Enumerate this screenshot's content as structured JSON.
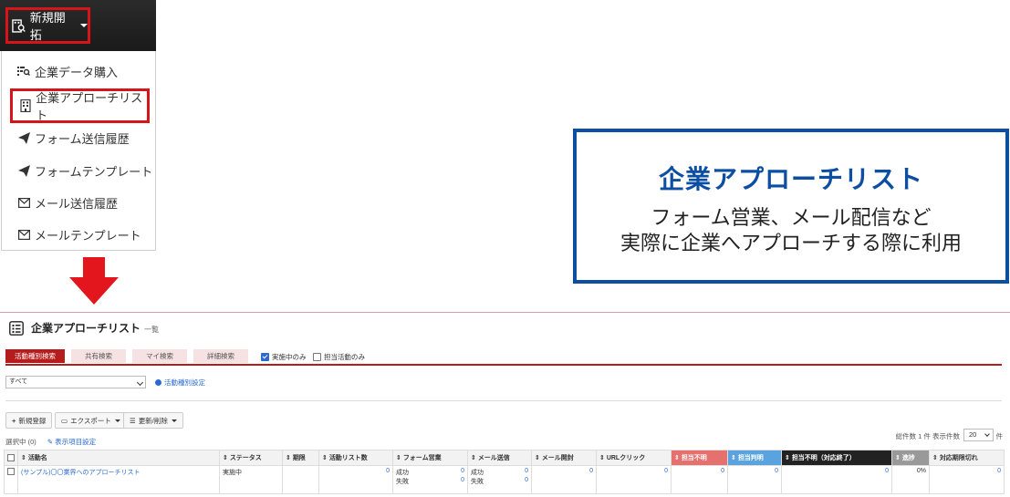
{
  "menu": {
    "button_label": "新規開拓",
    "items": [
      {
        "label": "企業データ購入",
        "icon": "list-search-icon"
      },
      {
        "label": "企業アプローチリスト",
        "icon": "building-icon"
      },
      {
        "label": "フォーム送信履歴",
        "icon": "send-icon"
      },
      {
        "label": "フォームテンプレート",
        "icon": "send-icon"
      },
      {
        "label": "メール送信履歴",
        "icon": "mail-icon"
      },
      {
        "label": "メールテンプレート",
        "icon": "mail-icon"
      }
    ]
  },
  "callout": {
    "title": "企業アプローチリスト",
    "line1": "フォーム営業、メール配信など",
    "line2": "実際に企業へアプローチする際に利用"
  },
  "app": {
    "title": "企業アプローチリスト",
    "subtitle": "一覧",
    "tabs": [
      "活動種別検索",
      "共有検索",
      "マイ検索",
      "詳細検索"
    ],
    "filters": {
      "active_only": "実施中のみ",
      "mine_only": "担当活動のみ"
    },
    "select_value": "すべて",
    "type_settings": "活動種別設定",
    "buttons": {
      "new": "新規登録",
      "export": "エクスポート",
      "update": "更新/削除"
    },
    "count_text": "総件数 1 件 表示件数",
    "page_size": "20",
    "unit": "件",
    "selected_text": "選択中 (0)",
    "display_settings": "表示項目設定",
    "columns": [
      "活動名",
      "ステータス",
      "期限",
      "活動リスト数",
      "フォーム営業",
      "メール送信",
      "メール開封",
      "URLクリック",
      "担当不明",
      "担当判明",
      "担当不明（対応終了）",
      "進捗",
      "対応期限切れ"
    ],
    "row": {
      "name": "(サンプル)〇〇業界へのアプローチリスト",
      "status": "実施中",
      "deadline": "",
      "list_count": "0",
      "form": {
        "success_label": "成功",
        "success": "0",
        "fail_label": "失敗",
        "fail": "0"
      },
      "mail": {
        "success_label": "成功",
        "success": "0",
        "fail_label": "失敗",
        "fail": "0"
      },
      "mail_open": "0",
      "url_click": "0",
      "unknown": "0",
      "known": "0",
      "unknown_closed": "0",
      "progress": "0%",
      "overdue": "0"
    }
  },
  "colors": {
    "accent_red": "#d7141a",
    "callout_blue": "#0b4ea2",
    "tab_red": "#b71c1c"
  }
}
